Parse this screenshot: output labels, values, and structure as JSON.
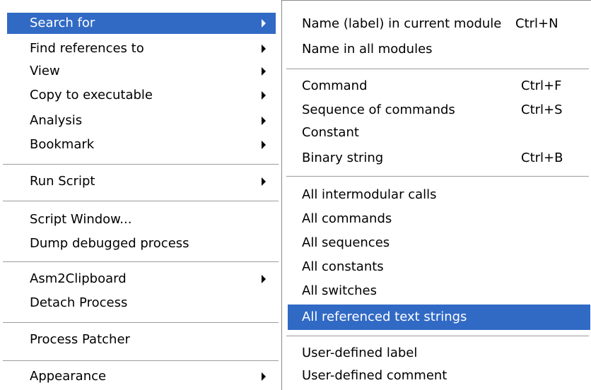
{
  "left_menu": {
    "items": [
      {
        "label": "Search for",
        "has_submenu": true,
        "selected": true
      },
      {
        "label": "Find references to",
        "has_submenu": true
      },
      {
        "label": "View",
        "has_submenu": true
      },
      {
        "label": "Copy to executable",
        "has_submenu": true
      },
      {
        "label": "Analysis",
        "has_submenu": true
      },
      {
        "label": "Bookmark",
        "has_submenu": true
      },
      {
        "label": "Run Script",
        "has_submenu": true
      },
      {
        "label": "Script Window...",
        "has_submenu": false
      },
      {
        "label": "Dump debugged process",
        "has_submenu": false
      },
      {
        "label": "Asm2Clipboard",
        "has_submenu": true
      },
      {
        "label": "Detach Process",
        "has_submenu": false
      },
      {
        "label": "Process Patcher",
        "has_submenu": false
      },
      {
        "label": "Appearance",
        "has_submenu": true
      }
    ]
  },
  "right_menu": {
    "items": [
      {
        "label": "Name (label) in current module",
        "shortcut": "Ctrl+N"
      },
      {
        "label": "Name in all modules",
        "shortcut": ""
      },
      {
        "label": "Command",
        "shortcut": "Ctrl+F"
      },
      {
        "label": "Sequence of commands",
        "shortcut": "Ctrl+S"
      },
      {
        "label": "Constant",
        "shortcut": ""
      },
      {
        "label": "Binary string",
        "shortcut": "Ctrl+B"
      },
      {
        "label": "All intermodular calls",
        "shortcut": ""
      },
      {
        "label": "All commands",
        "shortcut": ""
      },
      {
        "label": "All sequences",
        "shortcut": ""
      },
      {
        "label": "All constants",
        "shortcut": ""
      },
      {
        "label": "All switches",
        "shortcut": ""
      },
      {
        "label": "All referenced text strings",
        "shortcut": "",
        "selected": true
      },
      {
        "label": "User-defined label",
        "shortcut": ""
      },
      {
        "label": "User-defined comment",
        "shortcut": ""
      }
    ]
  },
  "colors": {
    "highlight": "#316ac5",
    "highlight_text": "#ffffff",
    "separator": "#9b9b9b"
  }
}
